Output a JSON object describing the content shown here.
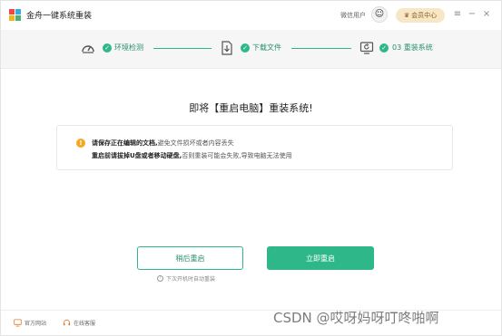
{
  "app": {
    "title": "金舟一键系统重装"
  },
  "titlebar": {
    "user_name": "微信用户",
    "vip_label": "会员中心"
  },
  "steps": [
    {
      "label": "环境检测",
      "icon": "gauge-icon"
    },
    {
      "label": "下载文件",
      "icon": "download-file-icon"
    },
    {
      "label": "03  重装系统",
      "icon": "reinstall-icon"
    }
  ],
  "main": {
    "title": "即将【重启电脑】重装系统!",
    "warning": {
      "line1_bold": "请保存正在编辑的文档,",
      "line1_rest": "避免文件损坏或者内容丢失",
      "line2_bold": "重启前请拔掉U盘或者移动硬盘,",
      "line2_rest": "否则重装可能会失败,导致电脑无法使用"
    },
    "buttons": {
      "later": "稍后重启",
      "now": "立即重启"
    },
    "hint": "下次开机时自动重装"
  },
  "footer": {
    "official_site": "官方网站",
    "online_service": "在线客服"
  },
  "watermark": "CSDN @哎呀妈呀叮咚啪啊",
  "colors": {
    "accent": "#2eb88a",
    "warning": "#f5a623",
    "vip_bg": "#f7e7c6"
  }
}
